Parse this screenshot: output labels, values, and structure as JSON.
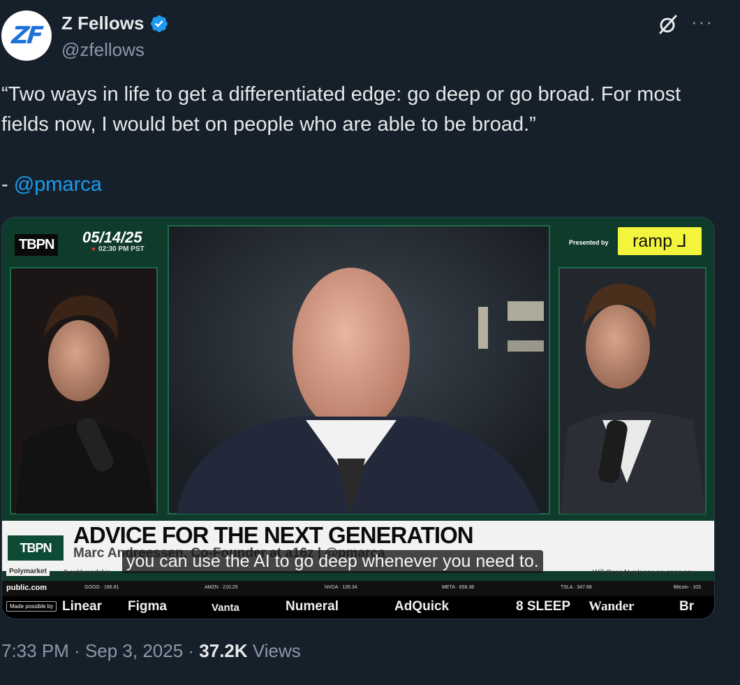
{
  "author": {
    "avatar_text": "ZF",
    "name": "Z Fellows",
    "handle": "@zfellows"
  },
  "tweet": {
    "text": "“Two ways in life to get a differentiated edge: go deep or go broad. For most fields now, I would bet on people who are able to be broad.”",
    "attribution_dash": "- ",
    "attribution_mention": "@pmarca"
  },
  "video": {
    "show_logo": "TBPN",
    "date": "05/14/25",
    "time": "02:30 PM PST",
    "presented_by": "Presented by",
    "sponsor_logo": "ramp ⅃",
    "banner_logo": "TBPN",
    "headline": "ADVICE FOR THE NEXT GENERATION",
    "subline": "Marc Andreessen, Co-Founder at a16z | @pmarca",
    "caption": "you can use the AI to go deep whenever you need to.",
    "polymarket": "Polymarket",
    "polymarket_text": "0 gold medal in",
    "polymarket_right": "Will OpenAI release an open sou",
    "public_com": "public.com",
    "tickers": [
      "GOOG · 166.81",
      "AMZN · 210.25",
      "NVDA · 135.34",
      "META · 658.36",
      "TSLA · 347.68",
      "Bitcoin · 103"
    ],
    "made_possible_by": "Made possible by",
    "sponsors": [
      "Linear",
      "Figma",
      "Vanta",
      "Numeral",
      "AdQuick",
      "8 SLEEP",
      "Wander",
      "Br"
    ]
  },
  "meta": {
    "time": "7:33 PM",
    "separator": " · ",
    "date": "Sep 3, 2025",
    "views_count": "37.2K",
    "views_label": " Views"
  },
  "colors": {
    "background": "#15202b",
    "accent": "#1d9bf0",
    "secondary_text": "#8b98a5"
  }
}
